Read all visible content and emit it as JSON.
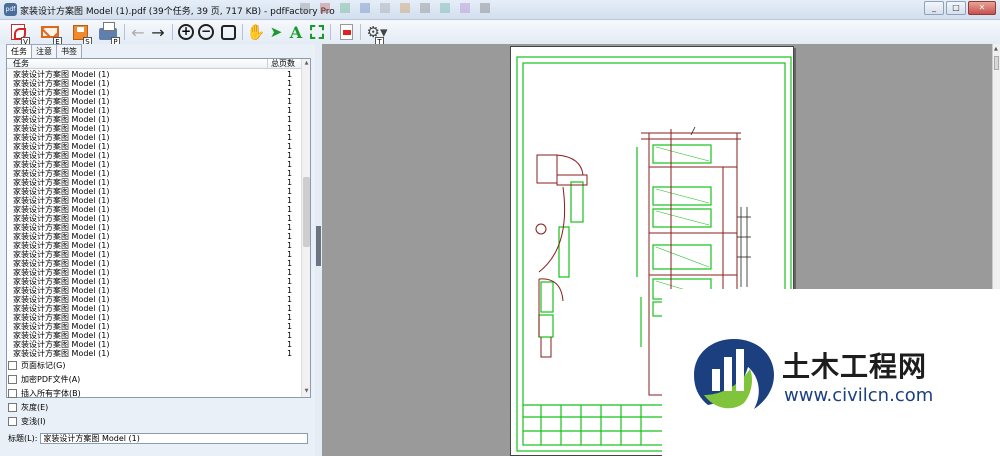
{
  "window": {
    "title": "家装设计方案图 Model (1).pdf (39个任务, 39 页, 717 KB) - pdfFactory Pro",
    "app_icon_text": "pdf"
  },
  "toolbar": {
    "keys": {
      "pdf": "V",
      "email": "E",
      "save": "S",
      "print": "P",
      "settings": "T"
    }
  },
  "tabs": [
    "任务",
    "注意",
    "书签"
  ],
  "list": {
    "col_task": "任务",
    "col_pages": "总页数",
    "rows": [
      {
        "task": "家装设计方案图 Model (1)",
        "pages": "1"
      },
      {
        "task": "家装设计方案图 Model (1)",
        "pages": "1"
      },
      {
        "task": "家装设计方案图 Model (1)",
        "pages": "1"
      },
      {
        "task": "家装设计方案图 Model (1)",
        "pages": "1"
      },
      {
        "task": "家装设计方案图 Model (1)",
        "pages": "1"
      },
      {
        "task": "家装设计方案图 Model (1)",
        "pages": "1"
      },
      {
        "task": "家装设计方案图 Model (1)",
        "pages": "1"
      },
      {
        "task": "家装设计方案图 Model (1)",
        "pages": "1"
      },
      {
        "task": "家装设计方案图 Model (1)",
        "pages": "1"
      },
      {
        "task": "家装设计方案图 Model (1)",
        "pages": "1"
      },
      {
        "task": "家装设计方案图 Model (1)",
        "pages": "1"
      },
      {
        "task": "家装设计方案图 Model (1)",
        "pages": "1"
      },
      {
        "task": "家装设计方案图 Model (1)",
        "pages": "1"
      },
      {
        "task": "家装设计方案图 Model (1)",
        "pages": "1"
      },
      {
        "task": "家装设计方案图 Model (1)",
        "pages": "1"
      },
      {
        "task": "家装设计方案图 Model (1)",
        "pages": "1"
      },
      {
        "task": "家装设计方案图 Model (1)",
        "pages": "1"
      },
      {
        "task": "家装设计方案图 Model (1)",
        "pages": "1"
      },
      {
        "task": "家装设计方案图 Model (1)",
        "pages": "1"
      },
      {
        "task": "家装设计方案图 Model (1)",
        "pages": "1"
      },
      {
        "task": "家装设计方案图 Model (1)",
        "pages": "1"
      },
      {
        "task": "家装设计方案图 Model (1)",
        "pages": "1"
      },
      {
        "task": "家装设计方案图 Model (1)",
        "pages": "1"
      },
      {
        "task": "家装设计方案图 Model (1)",
        "pages": "1"
      },
      {
        "task": "家装设计方案图 Model (1)",
        "pages": "1"
      },
      {
        "task": "家装设计方案图 Model (1)",
        "pages": "1"
      },
      {
        "task": "家装设计方案图 Model (1)",
        "pages": "1"
      },
      {
        "task": "家装设计方案图 Model (1)",
        "pages": "1"
      },
      {
        "task": "家装设计方案图 Model (1)",
        "pages": "1"
      },
      {
        "task": "家装设计方案图 Model (1)",
        "pages": "1"
      },
      {
        "task": "家装设计方案图 Model (1)",
        "pages": "1"
      },
      {
        "task": "家装设计方案图 Model (1)",
        "pages": "1"
      }
    ]
  },
  "options": [
    "页面标记(G)",
    "加密PDF文件(A)",
    "插入所有字体(B)",
    "灰度(E)",
    "变浅(I)"
  ],
  "title_field": {
    "label": "标题(L):",
    "value": "家装设计方案图 Model (1)"
  },
  "watermark": {
    "chinese": "土木工程网",
    "url": "www.civilcn.com"
  },
  "colors": {
    "drawing_green": "#16c21a",
    "drawing_red": "#8b1c1c",
    "watermark_blue": "#1c3f80"
  }
}
